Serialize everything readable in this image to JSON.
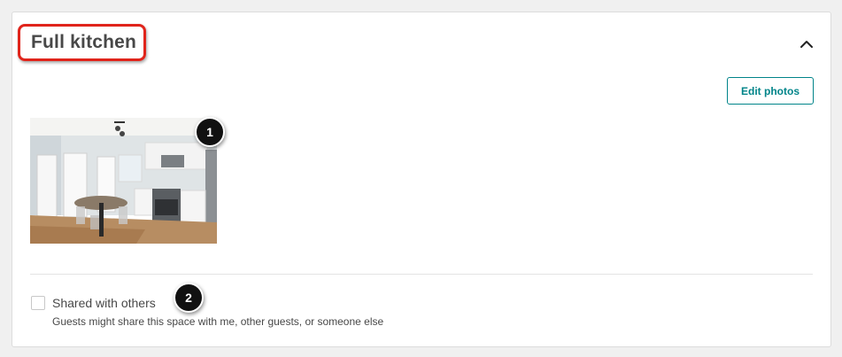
{
  "section": {
    "title": "Full kitchen",
    "collapse_icon": "chevron-up-icon"
  },
  "photos": {
    "edit_label": "Edit photos",
    "items": [
      {
        "description": "Kitchen photo"
      }
    ]
  },
  "callouts": [
    "1",
    "2"
  ],
  "shared": {
    "label": "Shared with others",
    "description": "Guests might share this space with me, other guests, or someone else",
    "checked": false
  },
  "colors": {
    "accent": "#008489",
    "highlight": "#e0241b",
    "text": "#484848"
  }
}
